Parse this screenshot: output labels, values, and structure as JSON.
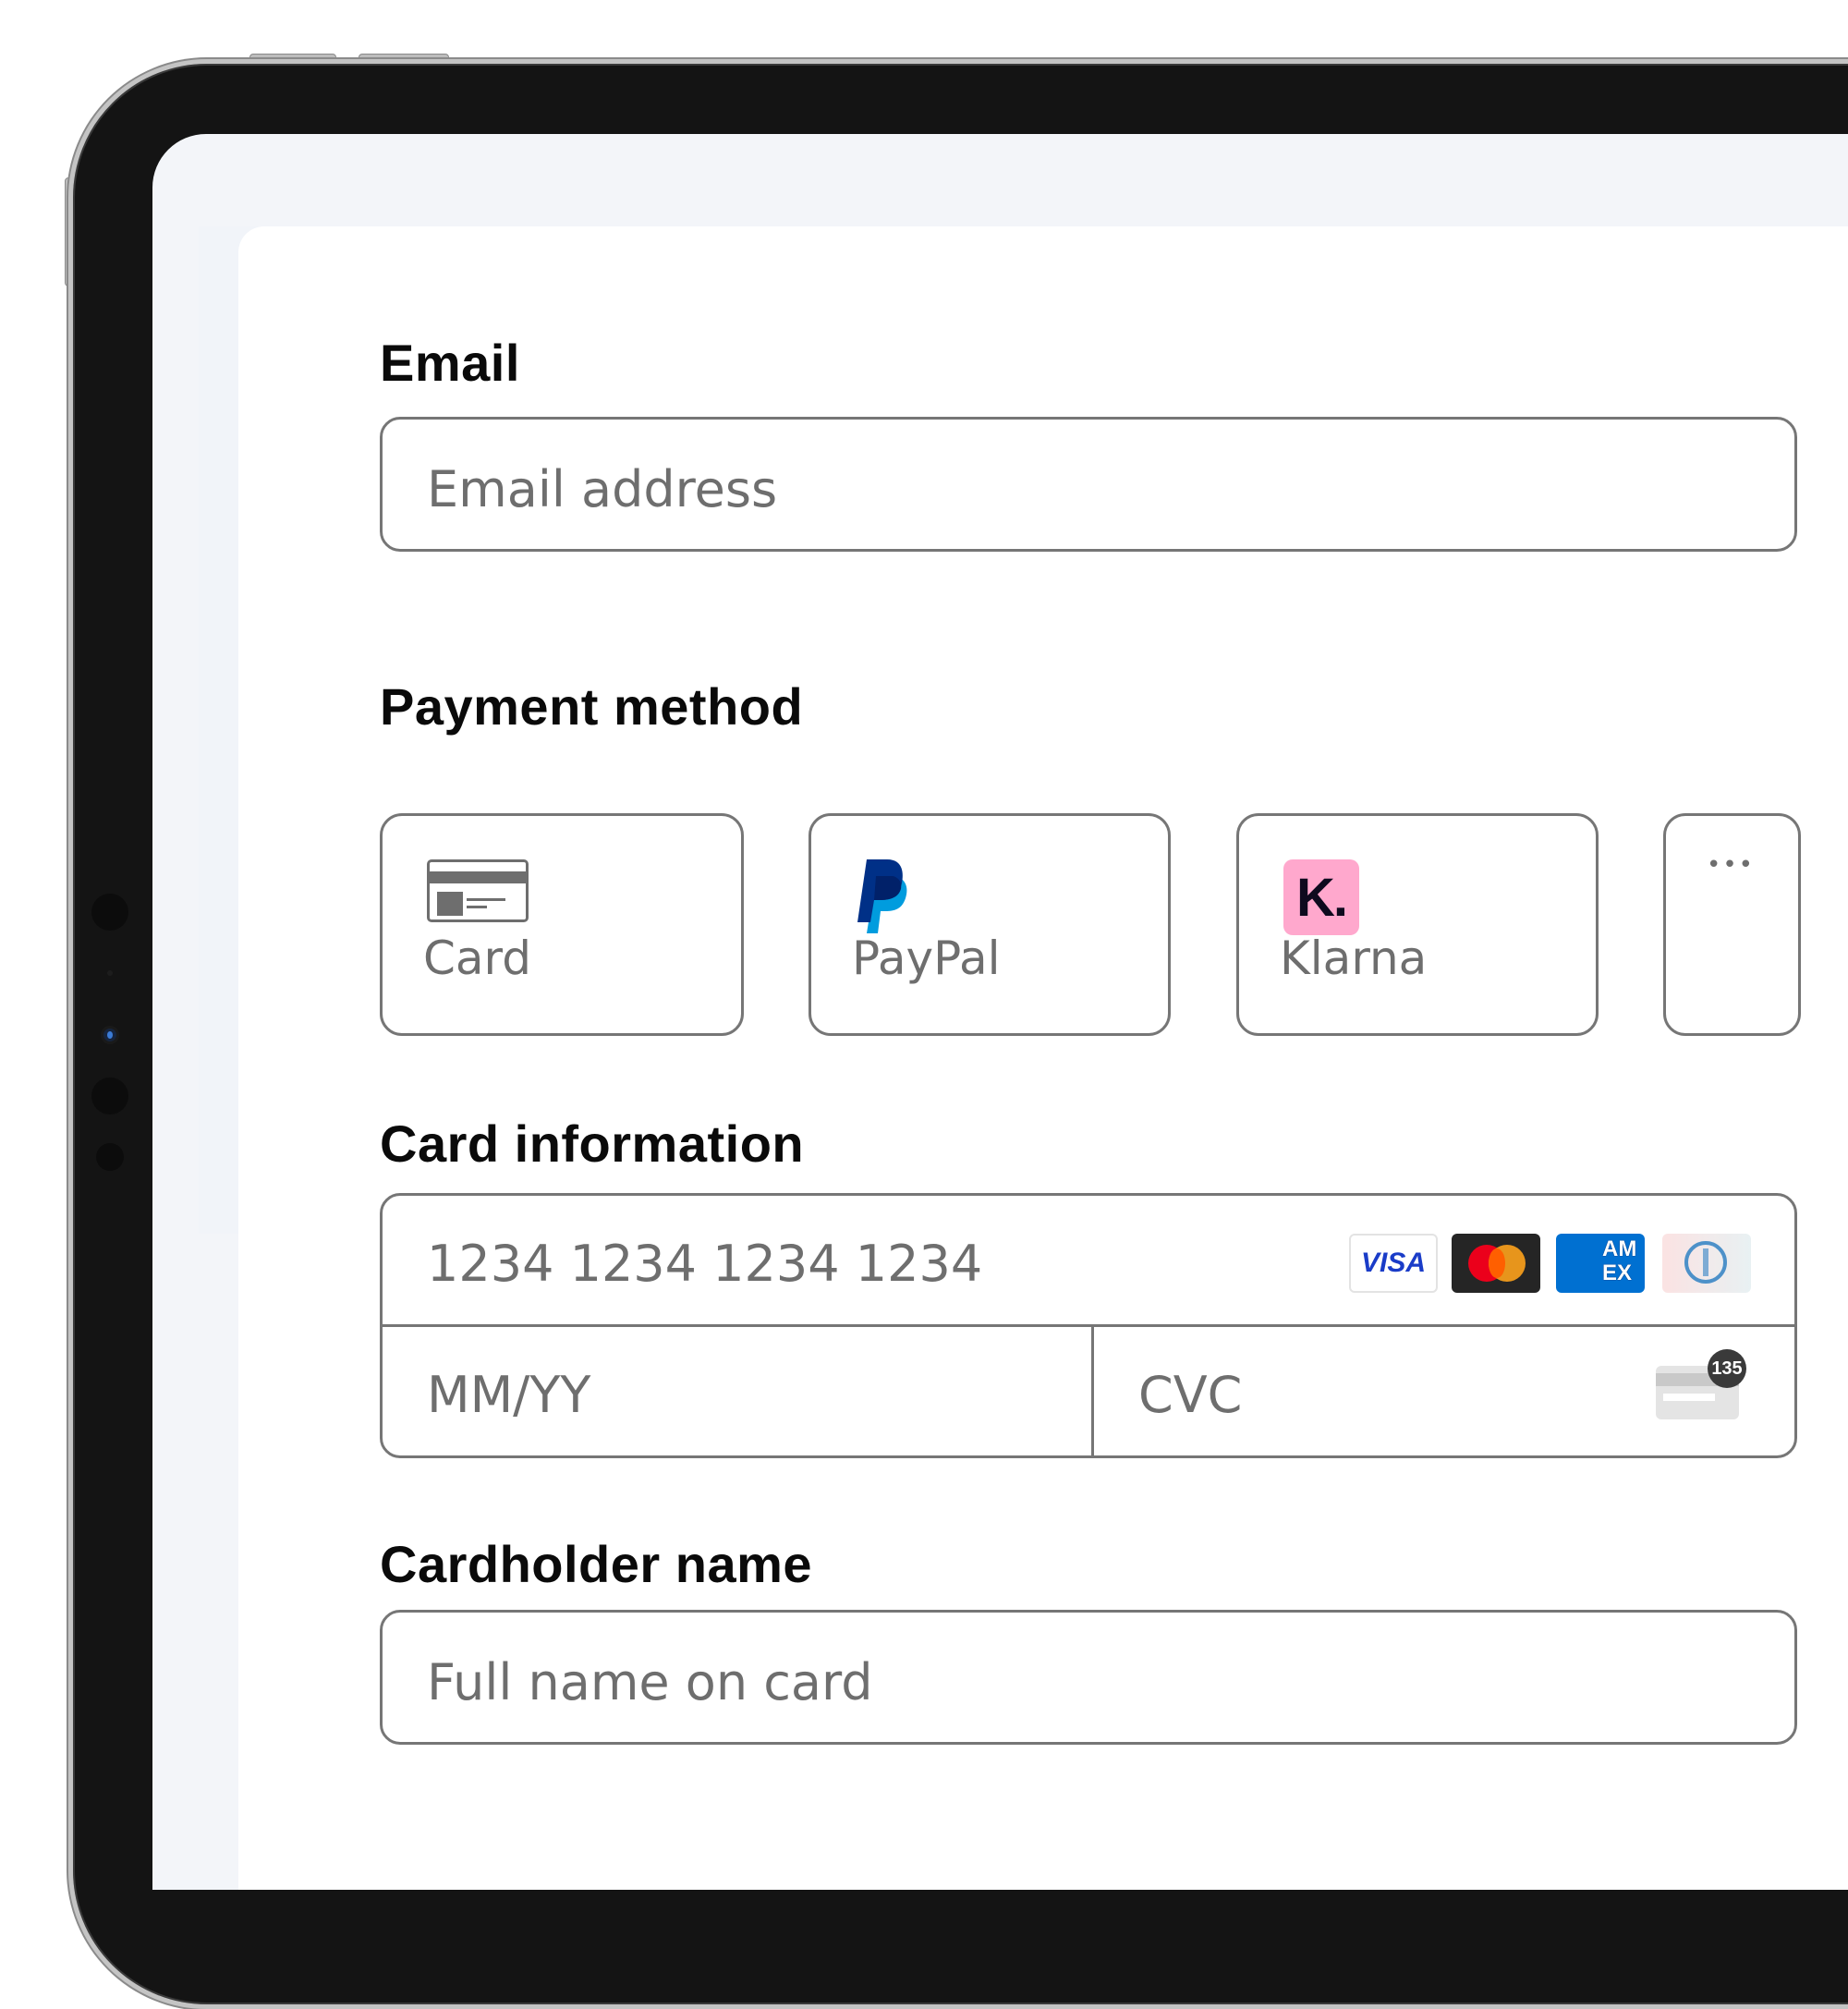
{
  "form": {
    "email": {
      "label": "Email",
      "placeholder": "Email address"
    },
    "payment_method": {
      "label": "Payment method",
      "options": [
        {
          "label": "Card",
          "icon": "credit-card-icon"
        },
        {
          "label": "PayPal",
          "icon": "paypal-logo-icon"
        },
        {
          "label": "Klarna",
          "icon": "klarna-logo-icon",
          "icon_text": "K."
        },
        {
          "label": "",
          "icon": "more-options-icon",
          "icon_text": "•••"
        }
      ]
    },
    "card_information": {
      "label": "Card information",
      "number_placeholder": "1234 1234 1234 1234",
      "expiry_placeholder": "MM/YY",
      "cvc_placeholder": "CVC",
      "cvc_hint_text": "135",
      "brands": [
        {
          "name": "visa",
          "text": "VISA",
          "color": "#1a1f71"
        },
        {
          "name": "mastercard",
          "text": "",
          "color": "#252525"
        },
        {
          "name": "amex",
          "text": "AM EX",
          "color": "#0070d1"
        },
        {
          "name": "diners",
          "text": "",
          "color": "#0079be"
        }
      ]
    },
    "cardholder": {
      "label": "Cardholder name",
      "placeholder": "Full name on card"
    }
  },
  "colors": {
    "border": "#767676",
    "placeholder": "#6e6e6e",
    "klarna_pink": "#ffa8cd",
    "paypal_dark": "#003087",
    "paypal_light": "#009cde"
  }
}
